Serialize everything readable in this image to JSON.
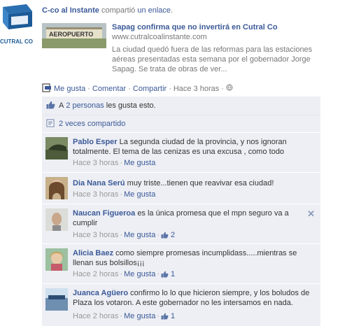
{
  "logo": {
    "text": "CUTRAL CO"
  },
  "header": {
    "author": "C-co al Instante",
    "verb_before": "compartió",
    "link": "un enlace",
    "period": "."
  },
  "attachment": {
    "thumb_label": "AEROPUERTO",
    "title": "Sapag confirma que no invertirá en Cutral Co",
    "url": "www.cutralcoalinstante.com",
    "description": "La ciudad quedó fuera de las reformas para las estaciones aéreas presentadas esta semana  por el gobernador Jorge Sapag. Se trata de obras de ver..."
  },
  "actions": {
    "like": "Me gusta",
    "comment": "Comentar",
    "share": "Compartir",
    "time": "Hace 3 horas",
    "sep": "·"
  },
  "likes": {
    "prefix": "A",
    "count_link": "2 personas",
    "suffix": "les gusta esto."
  },
  "shares": {
    "text": "2 veces compartido"
  },
  "comments": [
    {
      "author": "Pablo Esper",
      "text": "La segunda ciudad de la provincia, y nos ignoran totalmente. El tema de las cenizas es una excusa , como todo",
      "time": "Hace 3 horas",
      "like": "Me gusta",
      "likes": ""
    },
    {
      "author": "Dia Nana Serú",
      "text": "muy triste...tienen que reavivar esa ciudad!",
      "time": "Hace 3 horas",
      "like": "Me gusta",
      "likes": ""
    },
    {
      "author": "Naucan Figueroa",
      "text": "es la única promesa que el mpn seguro va a cumplir",
      "time": "Hace 3 horas",
      "like": "Me gusta",
      "likes": "2"
    },
    {
      "author": "Alicia Baez",
      "text": "como siempre promesas incumplidass.....mientras se llenan sus bolsillos¡¡¡",
      "time": "Hace 2 horas",
      "like": "Me gusta",
      "likes": "1"
    },
    {
      "author": "Juanca Agüero",
      "text": "confirmo lo lo que hicieron siempre, y los boludos de Plaza los votaron. A este gobernador no les intersamos en nada.",
      "time": "Hace 2 horas",
      "like": "Me gusta",
      "likes": "1"
    }
  ],
  "colors": {
    "link": "#3b5998",
    "ufi_bg": "#edeff4",
    "muted": "#999999"
  }
}
